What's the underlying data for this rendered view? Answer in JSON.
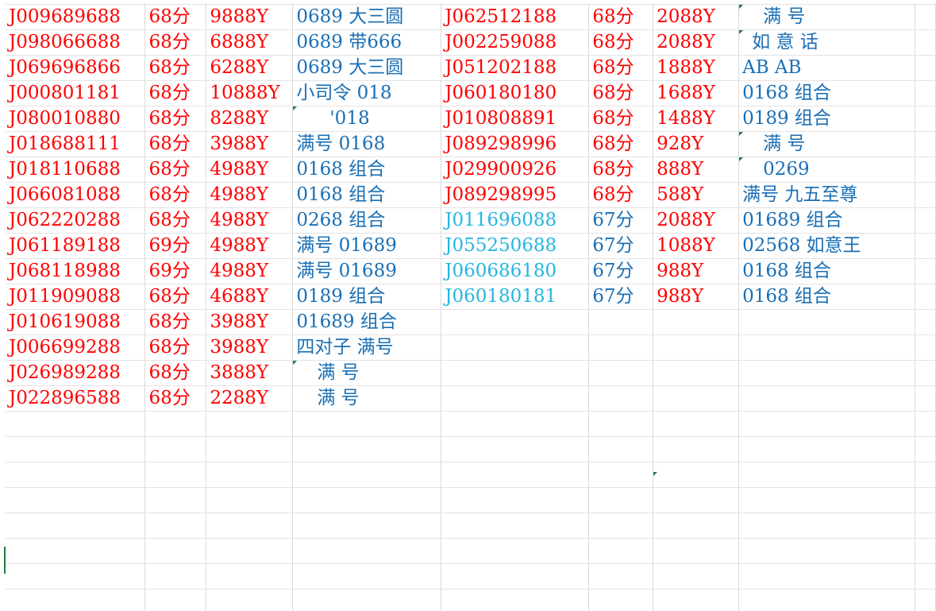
{
  "colors": {
    "red": "#ff0000",
    "blue": "#1a6fb5",
    "cyan": "#26b6e0",
    "grid": "#d9d9d9",
    "marker": "#1f7a3a"
  },
  "rows": [
    {
      "a": "J009689688",
      "b": "68分",
      "c": "9888Y",
      "d": "0689 大三圆",
      "e": "J062512188",
      "f": "68分",
      "g": "2088Y",
      "h": "满 号"
    },
    {
      "a": "J098066688",
      "b": "68分",
      "c": "6888Y",
      "d": "0689 带666",
      "e": "J002259088",
      "f": "68分",
      "g": "2088Y",
      "h": "如 意 话"
    },
    {
      "a": "J069696866",
      "b": "68分",
      "c": "6288Y",
      "d": "0689 大三圆",
      "e": "J051202188",
      "f": "68分",
      "g": "1888Y",
      "h": "AB AB"
    },
    {
      "a": "J000801181",
      "b": "68分",
      "c": "10888Y",
      "d": "小司令 018",
      "e": "J060180180",
      "f": "68分",
      "g": "1688Y",
      "h": "0168 组合"
    },
    {
      "a": "J080010880",
      "b": "68分",
      "c": "8288Y",
      "d": "'018",
      "e": "J010808891",
      "f": "68分",
      "g": "1488Y",
      "h": "0189 组合"
    },
    {
      "a": "J018688111",
      "b": "68分",
      "c": "3988Y",
      "d": "满号 0168",
      "e": "J089298996",
      "f": "68分",
      "g": "928Y",
      "h": "满 号"
    },
    {
      "a": "J018110688",
      "b": "68分",
      "c": "4988Y",
      "d": "0168 组合",
      "e": "J029900926",
      "f": "68分",
      "g": "888Y",
      "h": "0269"
    },
    {
      "a": "J066081088",
      "b": "68分",
      "c": "4988Y",
      "d": "0168 组合",
      "e": "J089298995",
      "f": "68分",
      "g": "588Y",
      "h": "满号 九五至尊"
    },
    {
      "a": "J062220288",
      "b": "68分",
      "c": "4988Y",
      "d": "0268 组合",
      "e": "J011696088",
      "f": "67分",
      "g": "2088Y",
      "h": "01689 组合"
    },
    {
      "a": "J061189188",
      "b": "69分",
      "c": "4988Y",
      "d": "满号 01689",
      "e": "J055250688",
      "f": "67分",
      "g": "1088Y",
      "h": "02568 如意王"
    },
    {
      "a": "J068118988",
      "b": "69分",
      "c": "4988Y",
      "d": "满号 01689",
      "e": "J060686180",
      "f": "67分",
      "g": "988Y",
      "h": "0168 组合"
    },
    {
      "a": "J011909088",
      "b": "68分",
      "c": "4688Y",
      "d": "0189 组合",
      "e": "J060180181",
      "f": "67分",
      "g": "988Y",
      "h": "0168 组合"
    },
    {
      "a": "J010619088",
      "b": "68分",
      "c": "3988Y",
      "d": "01689 组合"
    },
    {
      "a": "J006699288",
      "b": "68分",
      "c": "3988Y",
      "d": "四对子 满号"
    },
    {
      "a": "J026989288",
      "b": "68分",
      "c": "3888Y",
      "d": "满 号"
    },
    {
      "a": "J022896588",
      "b": "68分",
      "c": "2288Y",
      "d": "满 号"
    }
  ]
}
